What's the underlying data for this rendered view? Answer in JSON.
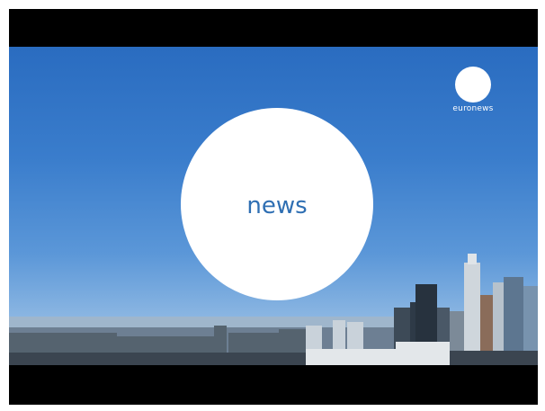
{
  "video": {
    "brand_logo_text": "euronews",
    "headline_word": "news"
  },
  "colors": {
    "letterbox": "#000000",
    "sky_top": "#2a6cc0",
    "sky_horizon": "#b7d0ea",
    "news_text": "#2f6fb3",
    "circle": "#ffffff"
  }
}
